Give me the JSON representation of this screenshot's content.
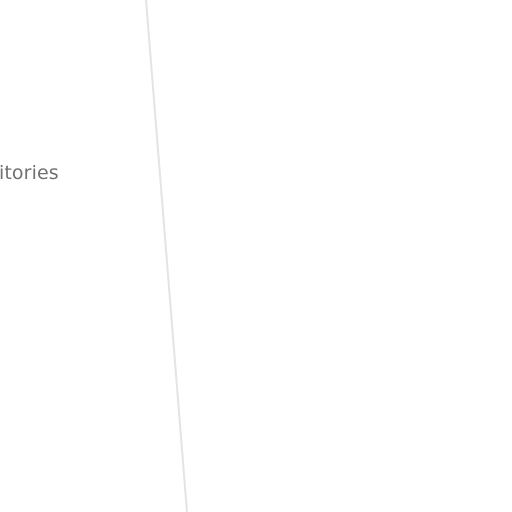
{
  "sidebar": {
    "partial_item_label": "itories"
  },
  "colors": {
    "label": "#707070",
    "divider": "#e4e4e4",
    "background": "#ffffff"
  }
}
